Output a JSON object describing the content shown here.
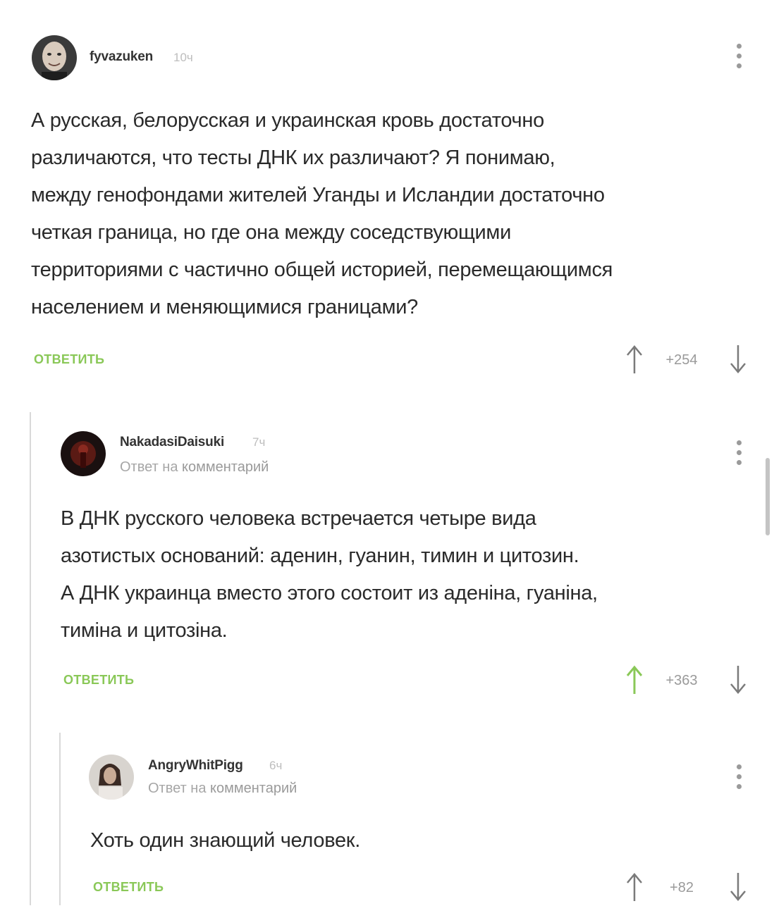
{
  "comments": [
    {
      "username": "fyvazuken",
      "time": "10ч",
      "reply_to": "",
      "reply_to_link": "",
      "text_lines": [
        "А русская, белорусская и украинская кровь достаточно",
        "различаются, что тесты ДНК их различают? Я понимаю,",
        "между генофондами жителей Уганды и Исландии достаточно",
        "четкая граница, но где она между соседствующими",
        "территориями с частично общей историей, перемещающимся",
        "населением и меняющимися границами?"
      ],
      "reply_label": "ОТВЕТИТЬ",
      "rating": "+254",
      "upvote_color": "#7a7a7a"
    },
    {
      "username": "NakadasiDaisuki",
      "time": "7ч",
      "reply_to": "Ответ на",
      "reply_to_link": "комментарий",
      "text_lines": [
        "В ДНК русского человека встречается четыре вида",
        "азотистых оснований: аденин, гуанин, тимин и цитозин.",
        "А ДНК украинца вместо этого состоит из аденіна, гуаніна,",
        "тиміна и цитозіна."
      ],
      "reply_label": "ОТВЕТИТЬ",
      "rating": "+363",
      "upvote_color": "#8ac858"
    },
    {
      "username": "AngryWhitPigg",
      "time": "6ч",
      "reply_to": "Ответ на",
      "reply_to_link": "комментарий",
      "text_lines": [
        "Хоть один знающий человек."
      ],
      "reply_label": "ОТВЕТИТЬ",
      "rating": "+82",
      "upvote_color": "#7a7a7a"
    }
  ],
  "colors": {
    "accent_green": "#8ac858",
    "thread_line": "#d9d9d9",
    "muted_text": "#9a9a9a"
  },
  "icons": {
    "more": "vertical-dots-icon",
    "upvote": "arrow-up-icon",
    "downvote": "arrow-down-icon"
  }
}
